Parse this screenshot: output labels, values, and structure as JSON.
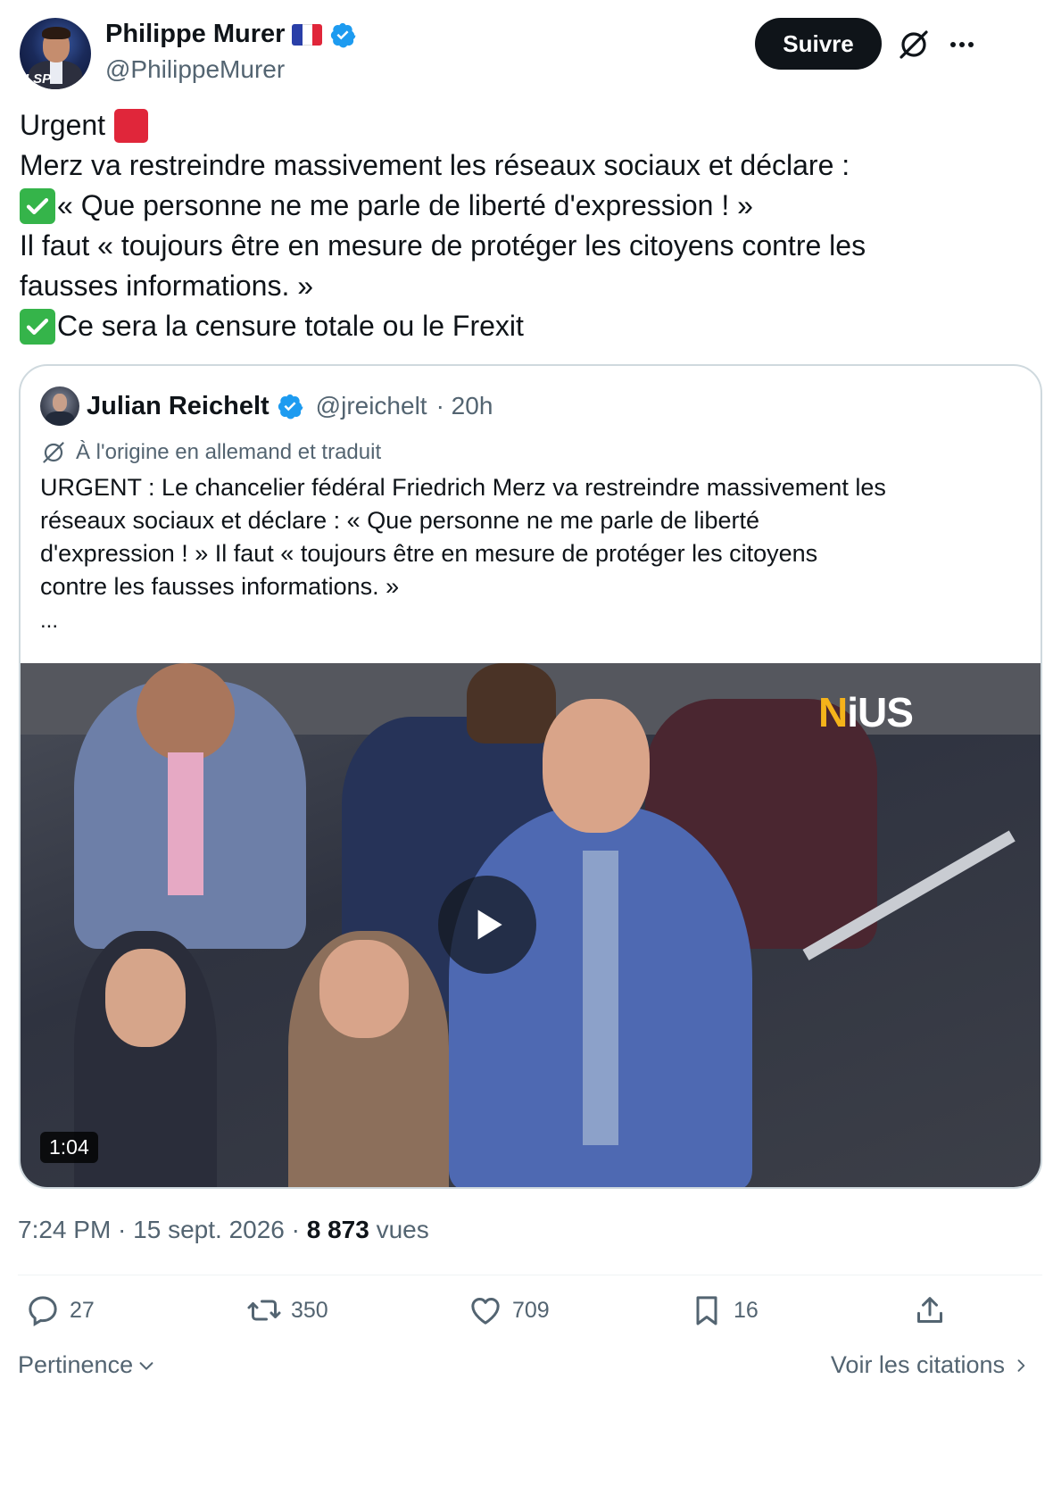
{
  "author": {
    "name": "Philippe Murer",
    "handle": "@PhilippeMurer",
    "avatar_label": "LSP"
  },
  "header": {
    "follow_label": "Suivre",
    "grok_icon": "grok-icon",
    "more_icon": "more-icon"
  },
  "tweet": {
    "lines": [
      "Urgent",
      "Merz va restreindre massivement les réseaux sociaux et déclare :",
      "« Que personne ne me parle de liberté d'expression ! »",
      "Il faut « toujours être en mesure de protéger les citoyens contre les",
      "fausses informations. »",
      "Ce sera la censure totale ou le Frexit"
    ]
  },
  "quote": {
    "name": "Julian Reichelt",
    "handle": "@jreichelt",
    "time": "· 20h",
    "translated_label": "À l'origine en allemand et traduit",
    "text_lines": [
      "URGENT : Le chancelier fédéral Friedrich Merz va restreindre massivement les",
      "réseaux sociaux et déclare : « Que personne ne me parle de liberté",
      "d'expression ! » Il faut « toujours être en mesure de protéger les citoyens",
      "contre les fausses informations. »"
    ],
    "ellipsis": "...",
    "video": {
      "duration": "1:04",
      "watermark_n": "N",
      "watermark_rest": "iUS"
    }
  },
  "meta": {
    "time": "7:24 PM · 15 sept. 2026 · ",
    "views_count": "8 873",
    "views_label": " vues"
  },
  "actions": {
    "replies": "27",
    "reposts": "350",
    "likes": "709",
    "bookmarks": "16"
  },
  "footer": {
    "sort_label": "Pertinence",
    "quotes_label": "Voir les citations"
  },
  "colors": {
    "text": "#0f1419",
    "secondary": "#536471",
    "verified": "#1d9bf0",
    "border": "#cfd9de",
    "check_emoji": "#35b44a",
    "red_square": "#e0263a",
    "watermark_accent": "#f5b31a"
  }
}
